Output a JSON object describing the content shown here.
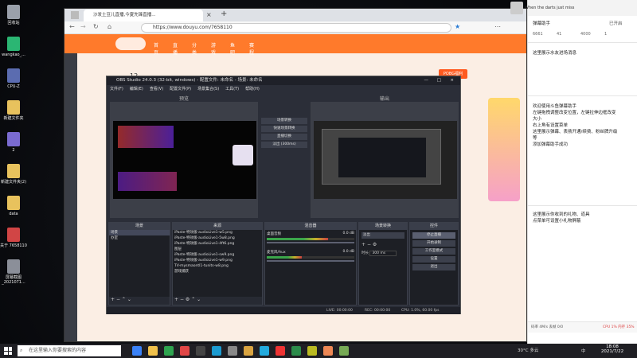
{
  "desktop": {
    "icons": [
      {
        "label": "回收站",
        "color": "#9aa0ab"
      },
      {
        "label": "wangkao_...",
        "color": "#2bb673"
      },
      {
        "label": "CPU-Z",
        "color": "#5b6cb0"
      },
      {
        "label": "新建文件夹",
        "color": "#e8c25d"
      },
      {
        "label": "2",
        "color": "#7a6bd1"
      },
      {
        "label": "新建文件夹(2)",
        "color": "#e8c25d"
      },
      {
        "label": "data",
        "color": "#e8c25d"
      },
      {
        "label": "关于 7658110",
        "color": "#d14545"
      },
      {
        "label": "屏幕截图_2021071...",
        "color": "#8b8f99"
      }
    ]
  },
  "browser": {
    "tab_title": "沙发土豆儿直播,今夏先锋直播...",
    "url": "https://www.douyu.com/7658110",
    "site_nav": [
      "首页",
      "直播",
      "分类",
      "游戏",
      "鱼吧",
      "赛程"
    ],
    "side_room_number": "12",
    "right_banner": "POBG福利"
  },
  "obs": {
    "title": "OBS Studio 24.0.3 (32-bit, windows) - 配置文件: 未命名 - 场景: 未命名",
    "menu": [
      "文件(F)",
      "编辑(E)",
      "查看(V)",
      "配置文件(P)",
      "场景集合(S)",
      "工具(T)",
      "帮助(H)"
    ],
    "preview_label": "预览",
    "program_label": "输出",
    "transition_buttons": [
      "场景转换",
      "快速场景转换",
      "直播切换",
      "淡出 (300ms)"
    ],
    "docks": {
      "scenes": {
        "title": "场景",
        "items": [
          "场景",
          "办室"
        ]
      },
      "sources": {
        "title": "来源",
        "items": [
          "iPaste-特效版-audioLive1-w5.png",
          "iPaste-特效版-audioLive1-5w8.png",
          "iPaste-特效版-audioLive1-4ft6.png",
          "图层",
          "iPaste-特效版-audioLive1-sw9.png",
          "iPaste-特效版-audioLive1-w9.png",
          "TV-mysmaontl1-tunits-w8.png",
          "游戏捕获"
        ]
      },
      "mixer": {
        "title": "混音器",
        "channels": [
          {
            "name": "桌面音频",
            "db": "0.0 dB",
            "level": 0.7
          },
          {
            "name": "麦克风/Aux",
            "db": "0.0 dB",
            "level": 0.4
          }
        ]
      },
      "transitions": {
        "title": "场景转换",
        "mode": "淡出",
        "duration_label": "时长",
        "duration": "300 ms"
      },
      "controls": {
        "title": "控件",
        "buttons": [
          "停止直播",
          "开始录制",
          "工作室模式",
          "设置",
          "退出"
        ]
      }
    },
    "status": {
      "live": "LIVE: 00:00:00",
      "rec": "REC: 00:00:00",
      "cpu": "CPU: 1.0%, 60.00 fps"
    }
  },
  "chat": {
    "header_name": "When the darts just miss",
    "title": "弹幕助手",
    "tab_label": "已开启",
    "stats": [
      "6661",
      "41",
      "4000",
      "1"
    ],
    "hint1": "这里展示水友进场消息",
    "welcome": [
      "欢迎使用斗鱼弹幕助手",
      "左键拖拽调整改变位置，左键拉伸边框改变",
      "大小",
      "右上角有设置菜单",
      "这里展示弹幕、表扬开通/续费、粉丝牌升级",
      "等",
      "添加弹幕助手成功"
    ],
    "hint2": [
      "这里展示你收到的礼物、道具",
      "点菜单可设置小礼物屏蔽"
    ],
    "footer_left": "码率 4M/s 丢帧 0/0",
    "footer_right": "CPU 1% 内存 35%"
  },
  "taskbar": {
    "search_placeholder": "在这里输入你要搜索的内容",
    "weather": "30°C 多云",
    "lang": "中",
    "time": "18:08",
    "date": "2021/7/22",
    "app_colors": [
      "#3a82f7",
      "#f0c14b",
      "#2ea44f",
      "#e04646",
      "#444",
      "#1b9bd1",
      "#888",
      "#d9a441",
      "#22aadd",
      "#e33",
      "#2c8c4b",
      "#bb2",
      "#e85",
      "#7a5"
    ]
  }
}
